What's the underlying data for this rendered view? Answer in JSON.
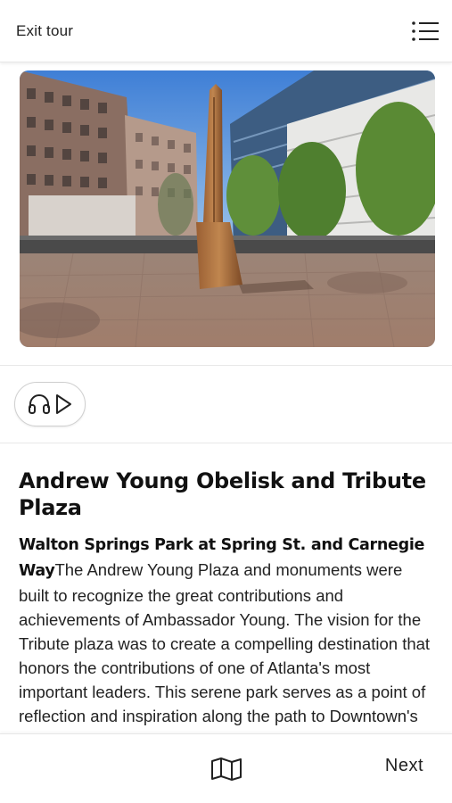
{
  "header": {
    "exit_label": "Exit tour",
    "menu_icon": "list-icon"
  },
  "media": {
    "image_description_icon": "obelisk-photo",
    "audio_icons": [
      "headphones-icon",
      "play-icon"
    ]
  },
  "stop": {
    "title": "Andrew Young Obelisk and Tribute Plaza",
    "location": "Walton Springs Park at Spring St. and Carnegie Way",
    "description": "The Andrew Young Plaza and monuments were built to recognize the great contributions and achievements of Ambassador Young. The vision for the Tribute plaza was to create a compelling destination that honors the contributions of one of Atlanta's most important leaders. This serene park serves as a point of reflection and inspiration along the path to Downtown's major destinations.\""
  },
  "footer": {
    "map_icon": "map-icon",
    "next_label": "Next"
  },
  "colors": {
    "text": "#111111",
    "border": "#e6e6e6"
  }
}
